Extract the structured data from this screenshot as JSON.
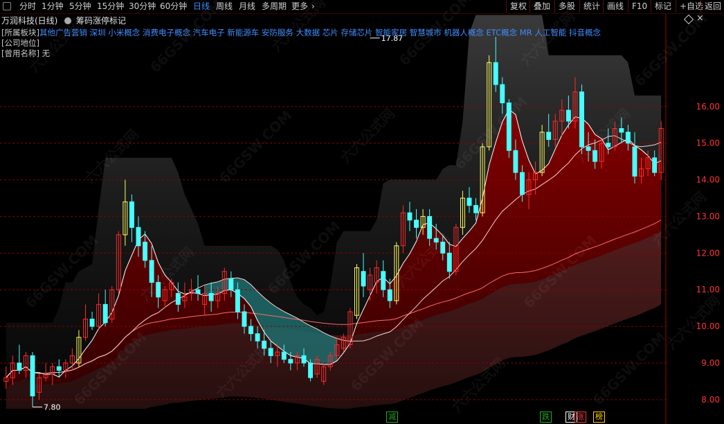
{
  "toolbar": {
    "periods": [
      "分时",
      "1分钟",
      "5分钟",
      "15分钟",
      "30分钟",
      "60分钟",
      "日线",
      "周线",
      "月线",
      "多周期",
      "更多"
    ],
    "active": "日线",
    "more_chevron": "›",
    "right_buttons": [
      "复权",
      "叠加",
      "多股",
      "统计",
      "画线",
      "F10",
      "标记",
      "+自选",
      "返回"
    ]
  },
  "header": {
    "stock_title": "万润科技(日线)",
    "indicator": "筹码涨停标记"
  },
  "info": {
    "sector_label": "[所属板块]",
    "sector_first": "其他广告营销",
    "sectors": "深圳 小米概念 消费电子概念 汽车电子 新能源车 安防服务 大数据 芯片 存储芯片 智能家居 智慧城市 机器人概念 ETC概念 MR 人工智能 抖音概念",
    "company_position": "[公司地位]",
    "former_name": "[曾用名称] 无"
  },
  "watermark": [
    "六六公式网",
    "66GSW.COM"
  ],
  "markers": [
    {
      "text": "减",
      "color": "#22aa22"
    },
    {
      "text": "跌",
      "color": "#22aa22"
    },
    {
      "text": "财",
      "color": "#ffffff"
    },
    {
      "text": "涨",
      "color": "#ff3333"
    },
    {
      "text": "榜",
      "color": "#ffcc00"
    }
  ],
  "colors": {
    "up": "#ff2a2a",
    "down": "#46ffff",
    "limit_up_outline": "#ffff66",
    "grid": "#8a0000",
    "axis_label": "#ff3333",
    "chip_red": "#8b0000",
    "chip_teal": "#1f6c6c"
  },
  "chart_data": {
    "type": "candlestick",
    "y_ticks": [
      8.0,
      9.0,
      10.0,
      11.0,
      12.0,
      13.0,
      14.0,
      15.0,
      16.0
    ],
    "ylim": [
      7.6,
      18.0
    ],
    "annotations": [
      {
        "text": "17.87",
        "price": 17.87,
        "bar": 55
      },
      {
        "text": "7.80",
        "price": 7.8,
        "bar": 4
      }
    ],
    "candles": [
      [
        8.5,
        8.9,
        8.3,
        8.6
      ],
      [
        8.6,
        9.2,
        8.4,
        9.0
      ],
      [
        9.0,
        9.5,
        8.7,
        8.8
      ],
      [
        8.8,
        9.3,
        8.6,
        9.2
      ],
      [
        9.2,
        9.3,
        7.8,
        8.1
      ],
      [
        8.2,
        8.7,
        8.0,
        8.6
      ],
      [
        8.6,
        9.0,
        8.5,
        8.7
      ],
      [
        8.7,
        9.0,
        8.4,
        8.9
      ],
      [
        8.9,
        9.1,
        8.6,
        8.8
      ],
      [
        8.8,
        9.1,
        8.6,
        9.0
      ],
      [
        9.0,
        9.4,
        8.8,
        9.2
      ],
      [
        9.0,
        9.9,
        8.9,
        9.7
      ],
      [
        9.7,
        10.6,
        9.6,
        10.2
      ],
      [
        10.2,
        10.4,
        9.9,
        10.0
      ],
      [
        10.0,
        10.9,
        9.9,
        10.6
      ],
      [
        10.6,
        11.0,
        10.0,
        10.1
      ],
      [
        10.2,
        11.1,
        10.1,
        11.0
      ],
      [
        11.0,
        12.6,
        10.9,
        12.5
      ],
      [
        12.5,
        14.0,
        12.2,
        13.4
      ],
      [
        13.4,
        13.6,
        12.3,
        12.7
      ],
      [
        12.7,
        13.0,
        11.9,
        12.2
      ],
      [
        12.3,
        12.6,
        11.6,
        11.8
      ],
      [
        11.8,
        12.2,
        10.8,
        11.2
      ],
      [
        11.2,
        11.4,
        10.5,
        10.8
      ],
      [
        10.7,
        11.1,
        10.5,
        11.0
      ],
      [
        11.0,
        11.3,
        10.8,
        11.2
      ],
      [
        10.9,
        11.2,
        10.4,
        10.6
      ],
      [
        10.7,
        11.2,
        10.5,
        10.8
      ],
      [
        10.9,
        11.3,
        10.7,
        11.0
      ],
      [
        11.0,
        11.4,
        10.7,
        10.9
      ],
      [
        10.6,
        11.1,
        10.3,
        10.9
      ],
      [
        10.9,
        11.2,
        10.4,
        10.7
      ],
      [
        10.7,
        11.1,
        10.5,
        10.9
      ],
      [
        10.9,
        11.6,
        10.7,
        11.5
      ],
      [
        11.3,
        11.5,
        10.8,
        11.0
      ],
      [
        11.0,
        11.2,
        10.2,
        10.4
      ],
      [
        10.4,
        10.6,
        9.8,
        10.0
      ],
      [
        10.0,
        10.2,
        9.6,
        9.8
      ],
      [
        9.8,
        10.0,
        9.4,
        9.6
      ],
      [
        9.6,
        9.9,
        9.2,
        9.4
      ],
      [
        9.4,
        9.6,
        9.0,
        9.2
      ],
      [
        9.2,
        9.5,
        8.9,
        9.3
      ],
      [
        9.3,
        9.5,
        9.0,
        9.1
      ],
      [
        9.1,
        9.3,
        8.8,
        9.0
      ],
      [
        9.0,
        9.3,
        8.8,
        9.2
      ],
      [
        9.2,
        9.4,
        8.9,
        9.0
      ],
      [
        9.0,
        9.1,
        8.5,
        8.6
      ],
      [
        8.7,
        9.2,
        8.6,
        9.1
      ],
      [
        8.5,
        9.0,
        8.4,
        8.9
      ],
      [
        8.9,
        9.3,
        8.8,
        9.2
      ],
      [
        9.2,
        9.7,
        9.1,
        9.5
      ],
      [
        9.4,
        9.8,
        9.3,
        9.7
      ],
      [
        9.5,
        10.5,
        9.4,
        10.4
      ],
      [
        10.3,
        11.7,
        10.2,
        11.6
      ],
      [
        11.5,
        12.0,
        10.8,
        11.1
      ],
      [
        11.0,
        11.6,
        10.7,
        11.4
      ],
      [
        11.2,
        11.8,
        10.9,
        11.6
      ],
      [
        11.5,
        11.8,
        10.8,
        11.0
      ],
      [
        11.0,
        11.3,
        10.5,
        10.7
      ],
      [
        10.7,
        12.3,
        10.6,
        12.2
      ],
      [
        12.2,
        13.3,
        12.0,
        13.1
      ],
      [
        13.1,
        13.4,
        12.6,
        12.9
      ],
      [
        12.9,
        13.2,
        12.4,
        12.7
      ],
      [
        12.7,
        13.2,
        12.5,
        13.0
      ],
      [
        13.0,
        13.2,
        12.2,
        12.4
      ],
      [
        12.4,
        12.8,
        12.1,
        12.3
      ],
      [
        12.3,
        12.5,
        11.8,
        12.0
      ],
      [
        12.0,
        12.3,
        11.3,
        11.5
      ],
      [
        11.5,
        12.8,
        11.4,
        12.7
      ],
      [
        12.7,
        13.7,
        12.5,
        13.5
      ],
      [
        13.5,
        13.8,
        13.1,
        13.3
      ],
      [
        13.3,
        13.5,
        12.9,
        13.1
      ],
      [
        13.1,
        15.0,
        13.0,
        14.9
      ],
      [
        14.9,
        17.4,
        14.8,
        17.2
      ],
      [
        17.2,
        17.9,
        16.4,
        16.6
      ],
      [
        16.6,
        16.8,
        15.8,
        16.1
      ],
      [
        16.1,
        16.2,
        14.6,
        14.8
      ],
      [
        14.8,
        15.1,
        14.0,
        14.2
      ],
      [
        14.2,
        14.4,
        13.4,
        13.6
      ],
      [
        13.6,
        14.2,
        13.2,
        14.0
      ],
      [
        14.0,
        14.5,
        13.6,
        14.2
      ],
      [
        14.2,
        15.5,
        14.1,
        15.3
      ],
      [
        15.3,
        15.8,
        14.9,
        15.1
      ],
      [
        15.1,
        15.8,
        14.9,
        15.6
      ],
      [
        15.6,
        16.2,
        15.2,
        15.9
      ],
      [
        15.9,
        16.3,
        15.4,
        15.6
      ],
      [
        15.6,
        16.8,
        15.4,
        16.4
      ],
      [
        16.4,
        16.6,
        14.7,
        14.9
      ],
      [
        14.9,
        15.3,
        14.5,
        14.8
      ],
      [
        14.8,
        15.1,
        14.3,
        14.5
      ],
      [
        14.5,
        15.1,
        14.3,
        15.0
      ],
      [
        15.0,
        15.4,
        14.7,
        14.9
      ],
      [
        14.9,
        15.6,
        14.8,
        15.4
      ],
      [
        15.4,
        15.7,
        15.0,
        15.3
      ],
      [
        15.3,
        15.5,
        14.8,
        15.0
      ],
      [
        14.9,
        15.3,
        13.9,
        14.1
      ],
      [
        14.1,
        14.6,
        13.9,
        14.3
      ],
      [
        14.3,
        14.8,
        14.1,
        14.6
      ],
      [
        14.6,
        14.8,
        14.1,
        14.2
      ],
      [
        14.2,
        15.6,
        14.0,
        15.4
      ]
    ],
    "limit_up_bars": [
      11,
      18,
      53,
      59,
      63,
      69,
      72,
      73,
      81
    ]
  }
}
